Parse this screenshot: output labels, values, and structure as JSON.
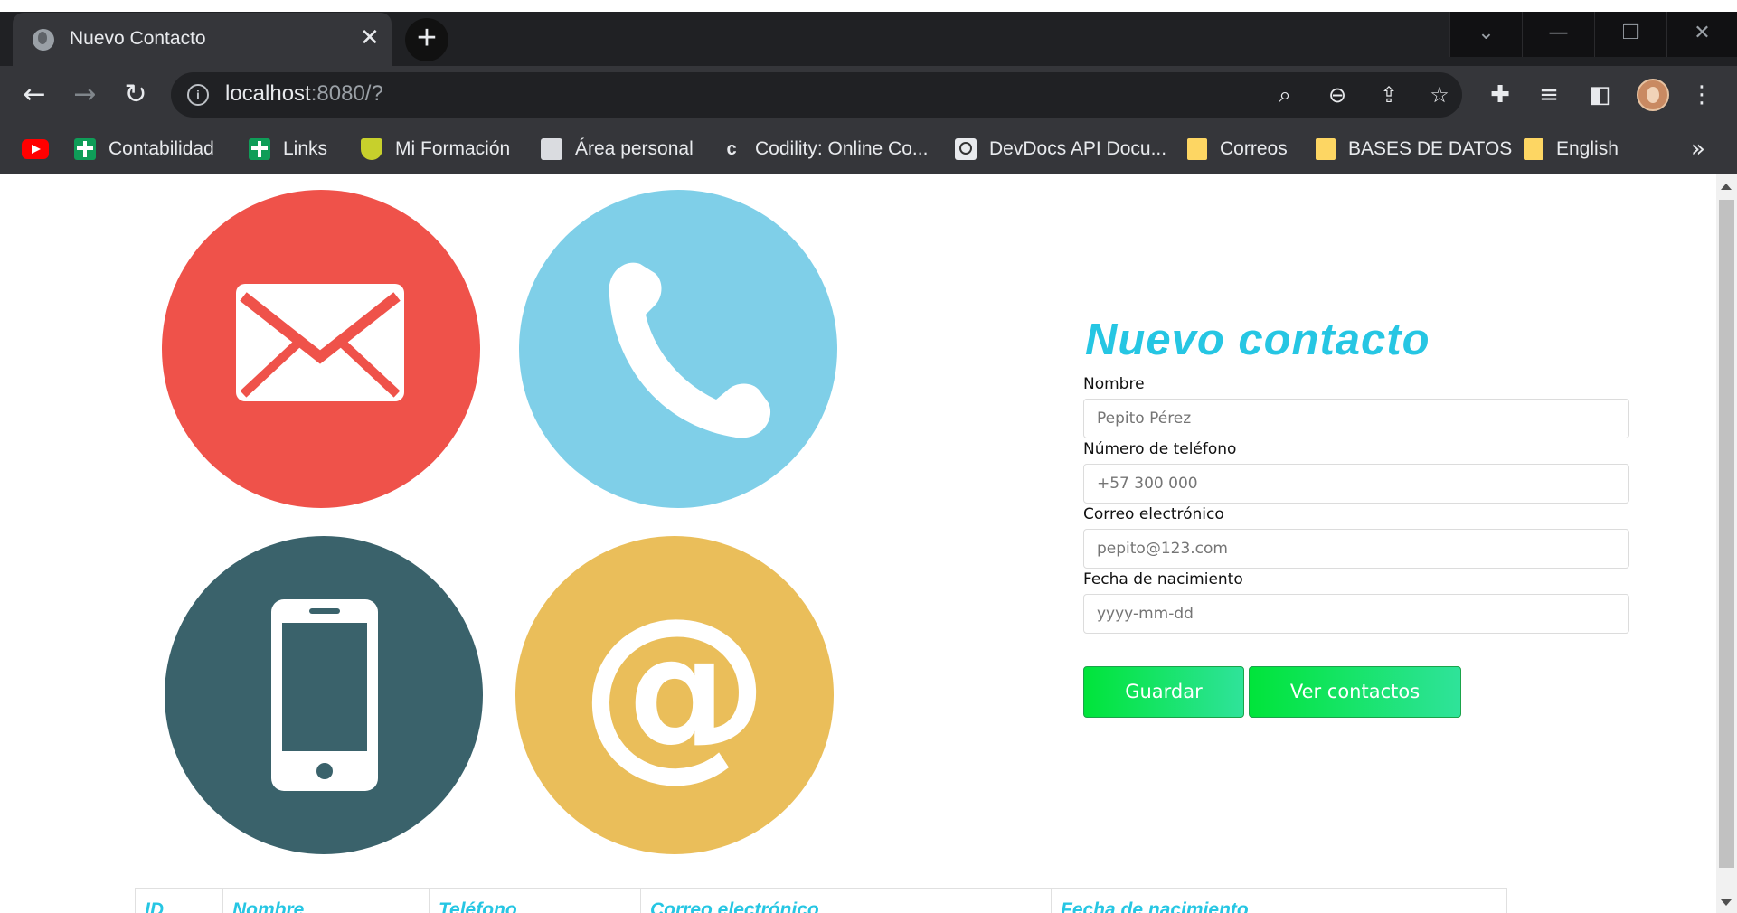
{
  "browser": {
    "tab_title": "Nuevo Contacto",
    "url_host": "localhost",
    "url_rest": ":8080/?",
    "bookmarks": [
      {
        "label": "",
        "icon": "youtube-icon"
      },
      {
        "label": "Contabilidad",
        "icon": "sheets-icon"
      },
      {
        "label": "Links",
        "icon": "sheets-icon"
      },
      {
        "label": "Mi Formación",
        "icon": "shield-icon"
      },
      {
        "label": "Área personal",
        "icon": "document-icon"
      },
      {
        "label": "Codility: Online Co...",
        "icon": "codility-icon"
      },
      {
        "label": "DevDocs API Docu...",
        "icon": "devdocs-icon"
      },
      {
        "label": "Correos",
        "icon": "folder-icon"
      },
      {
        "label": "BASES DE DATOS",
        "icon": "folder-icon"
      },
      {
        "label": "English",
        "icon": "folder-icon"
      }
    ]
  },
  "form": {
    "title": "Nuevo contacto",
    "name_label": "Nombre",
    "name_placeholder": "Pepito Pérez",
    "phone_label": "Número de teléfono",
    "phone_placeholder": "+57 300 000",
    "email_label": "Correo electrónico",
    "email_placeholder": "pepito@123.com",
    "birth_label": "Fecha de nacimiento",
    "birth_placeholder": "yyyy-mm-dd",
    "save_label": "Guardar",
    "view_label": "Ver contactos"
  },
  "table": {
    "headers": [
      "ID",
      "Nombre",
      "Teléfono",
      "Correo electrónico",
      "Fecha de nacimiento"
    ]
  },
  "colors": {
    "accent": "#26c6e3",
    "button_gradient_start": "#00e43a",
    "button_gradient_end": "#2fe39a",
    "mail_circle": "#ef524a",
    "phone_circle": "#7fcfe8",
    "mobile_circle": "#3a626b",
    "at_circle": "#eabe5a"
  }
}
